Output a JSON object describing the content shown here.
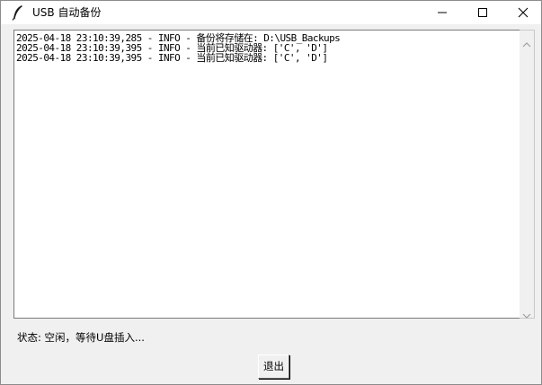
{
  "window": {
    "title": "USB 自动备份",
    "app_icon": "feather-icon",
    "controls": [
      "minimize-icon",
      "maximize-icon",
      "close-icon"
    ]
  },
  "log": {
    "lines": [
      "2025-04-18 23:10:39,285 - INFO - 备份将存储在: D:\\USB_Backups",
      "2025-04-18 23:10:39,395 - INFO - 当前已知驱动器: ['C', 'D']",
      "2025-04-18 23:10:39,395 - INFO - 当前已知驱动器: ['C', 'D']"
    ]
  },
  "status": {
    "text": "状态: 空闲，等待U盘插入..."
  },
  "actions": {
    "exit_label": "退出"
  },
  "colors": {
    "window_bg": "#f0f0f0",
    "titlebar_bg": "#ffffff",
    "text_area_bg": "#ffffff"
  }
}
